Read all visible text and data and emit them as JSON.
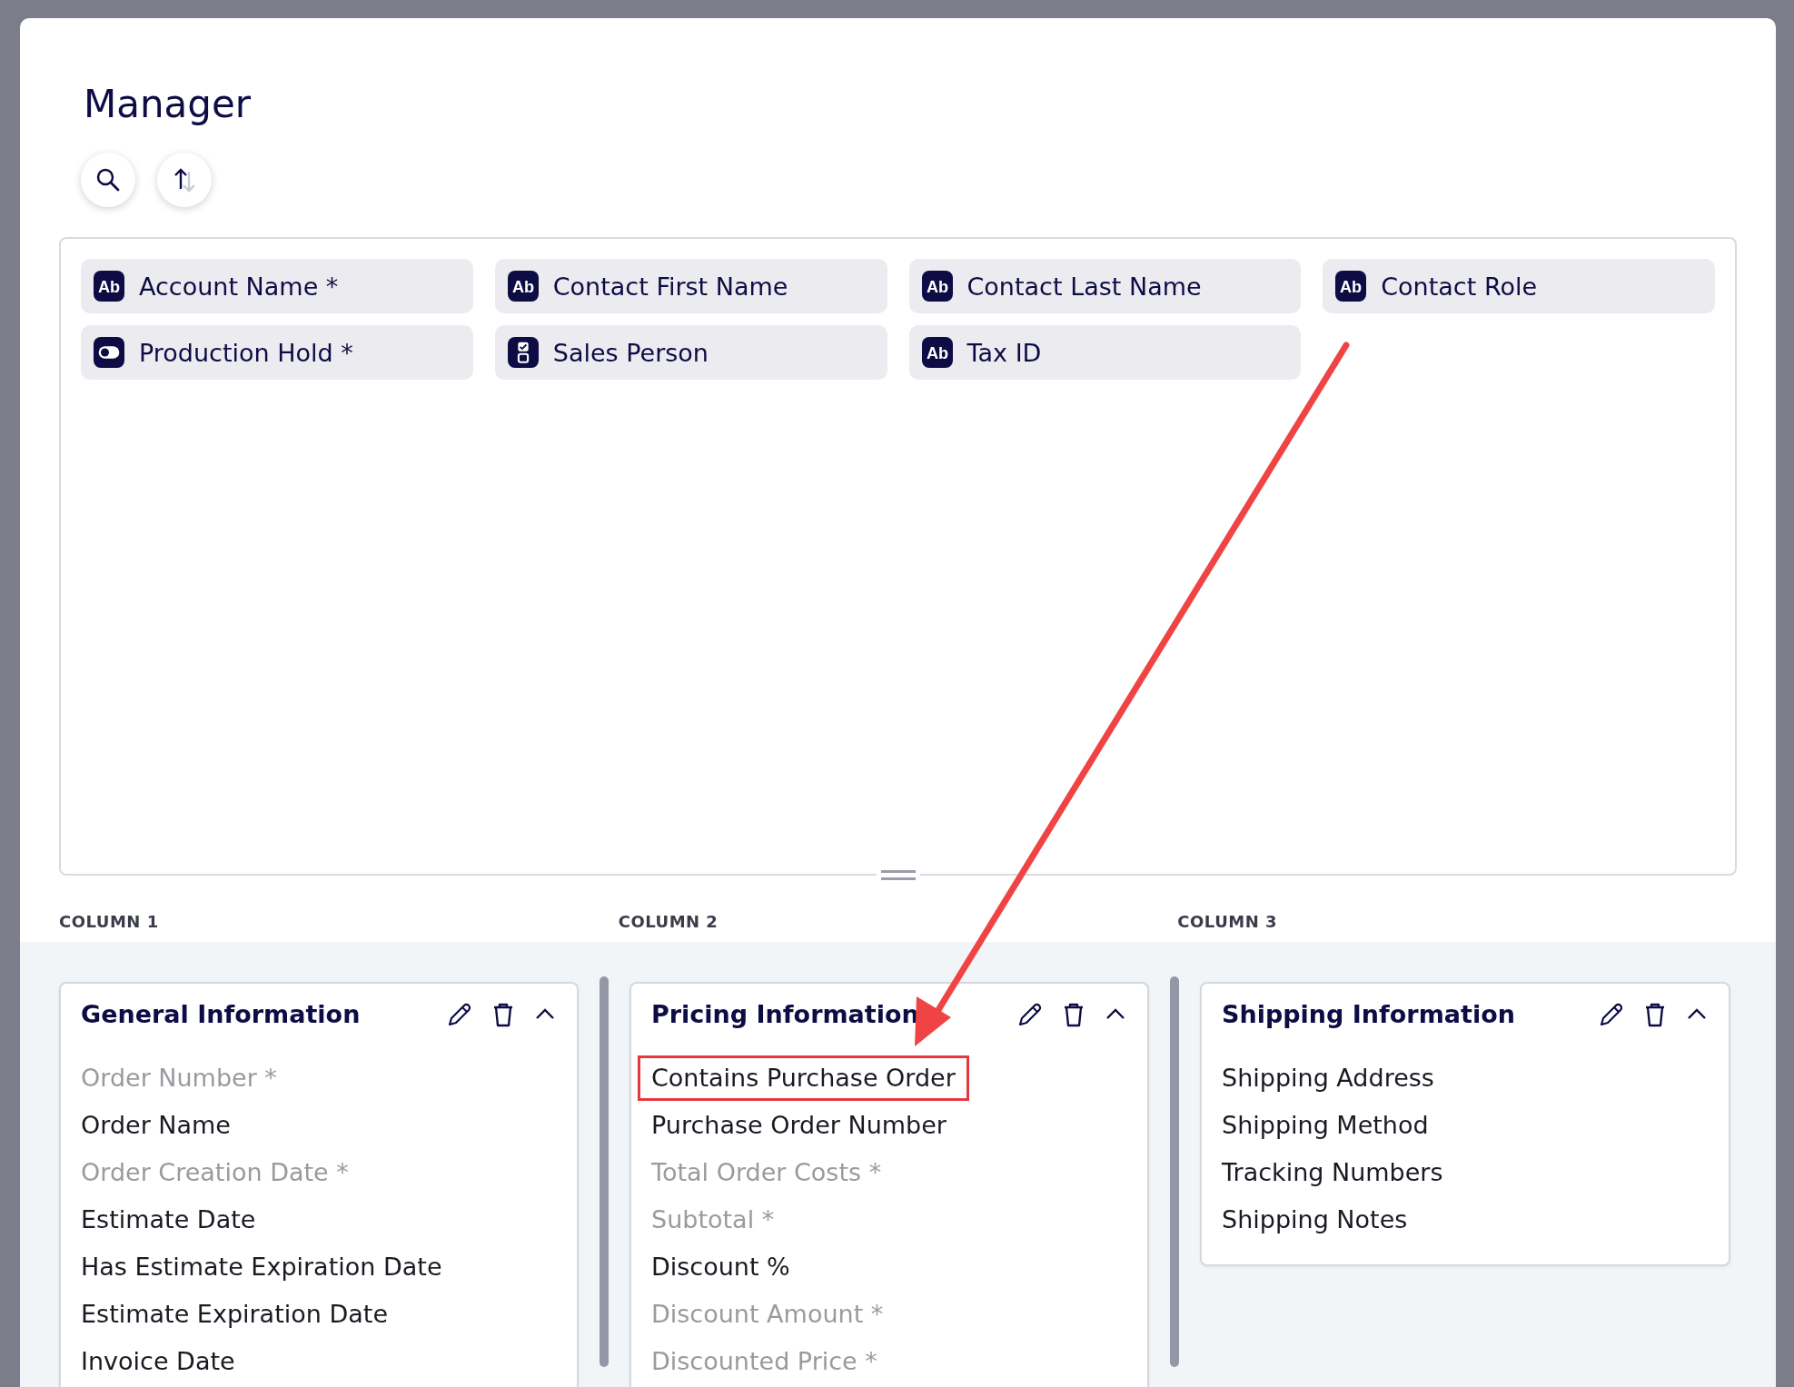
{
  "title": "Manager",
  "toolbar": [
    {
      "kind": "search"
    },
    {
      "kind": "sort"
    }
  ],
  "fields": [
    {
      "label": "Account Name *",
      "kind": "text",
      "icon_text": "Ab"
    },
    {
      "label": "Contact First Name",
      "kind": "text",
      "icon_text": "Ab"
    },
    {
      "label": "Contact Last Name",
      "kind": "text",
      "icon_text": "Ab"
    },
    {
      "label": "Contact Role",
      "kind": "text",
      "icon_text": "Ab"
    },
    {
      "label": "Production Hold *",
      "kind": "toggle"
    },
    {
      "label": "Sales Person",
      "kind": "choice"
    },
    {
      "label": "Tax ID",
      "kind": "text",
      "icon_text": "Ab"
    }
  ],
  "columns": [
    {
      "label": "COLUMN 1",
      "section": {
        "title": "General Information",
        "items": [
          {
            "label": "Order Number *",
            "disabled": true,
            "highlighted": false
          },
          {
            "label": "Order Name",
            "disabled": false,
            "highlighted": false
          },
          {
            "label": "Order Creation Date *",
            "disabled": true,
            "highlighted": false
          },
          {
            "label": "Estimate Date",
            "disabled": false,
            "highlighted": false
          },
          {
            "label": "Has Estimate Expiration Date",
            "disabled": false,
            "highlighted": false
          },
          {
            "label": "Estimate Expiration Date",
            "disabled": false,
            "highlighted": false
          },
          {
            "label": "Invoice Date",
            "disabled": false,
            "highlighted": false
          }
        ]
      }
    },
    {
      "label": "COLUMN 2",
      "section": {
        "title": "Pricing Information",
        "items": [
          {
            "label": "Contains Purchase Order",
            "disabled": false,
            "highlighted": true
          },
          {
            "label": "Purchase Order Number",
            "disabled": false,
            "highlighted": false
          },
          {
            "label": "Total Order Costs *",
            "disabled": true,
            "highlighted": false
          },
          {
            "label": "Subtotal *",
            "disabled": true,
            "highlighted": false
          },
          {
            "label": "Discount %",
            "disabled": false,
            "highlighted": false
          },
          {
            "label": "Discount Amount *",
            "disabled": true,
            "highlighted": false
          },
          {
            "label": "Discounted Price *",
            "disabled": true,
            "highlighted": false
          }
        ]
      }
    },
    {
      "label": "COLUMN 3",
      "section": {
        "title": "Shipping Information",
        "items": [
          {
            "label": "Shipping Address",
            "disabled": false,
            "highlighted": false
          },
          {
            "label": "Shipping Method",
            "disabled": false,
            "highlighted": false
          },
          {
            "label": "Tracking Numbers",
            "disabled": false,
            "highlighted": false
          },
          {
            "label": "Shipping Notes",
            "disabled": false,
            "highlighted": false
          }
        ]
      }
    }
  ],
  "annotation_arrow": true
}
